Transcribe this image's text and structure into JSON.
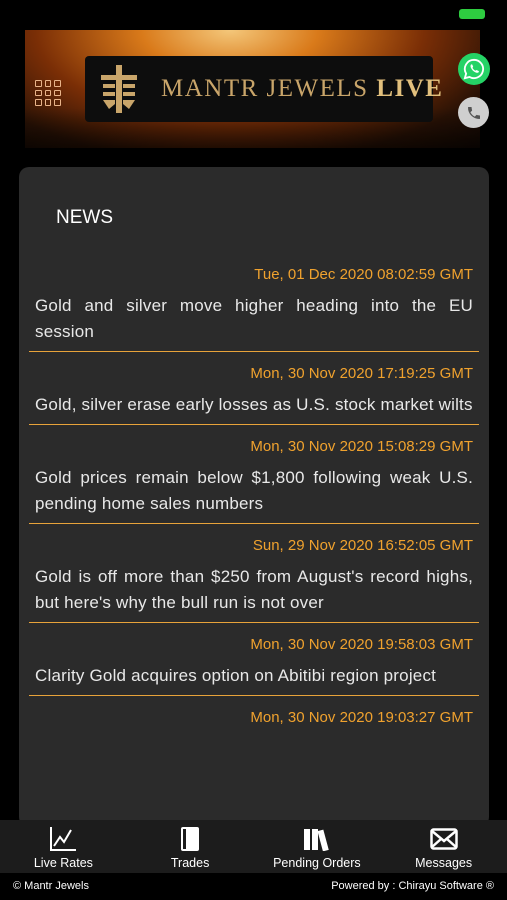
{
  "status_bar": {
    "battery_color": "#2ecc40"
  },
  "header": {
    "brand_text": "MANTR JEWELS",
    "brand_suffix": "LIVE",
    "menu_icon": "grid-menu-icon",
    "whatsapp_icon": "whatsapp-icon",
    "phone_icon": "phone-icon"
  },
  "news": {
    "title": "NEWS",
    "items": [
      {
        "date": "Tue, 01 Dec 2020 08:02:59 GMT",
        "headline": "Gold and silver move higher heading into the EU session"
      },
      {
        "date": "Mon, 30 Nov 2020 17:19:25 GMT",
        "headline": "Gold, silver erase early losses as U.S. stock market wilts"
      },
      {
        "date": "Mon, 30 Nov 2020 15:08:29 GMT",
        "headline": "Gold prices remain below $1,800 following weak U.S. pending home sales numbers"
      },
      {
        "date": "Sun, 29 Nov 2020 16:52:05 GMT",
        "headline": "Gold is off more than $250 from August's record highs, but here's why the bull run is not over"
      },
      {
        "date": "Mon, 30 Nov 2020 19:58:03 GMT",
        "headline": "Clarity Gold acquires option on Abitibi region project"
      },
      {
        "date": "Mon, 30 Nov 2020 19:03:27 GMT",
        "headline": ""
      }
    ]
  },
  "tabbar": {
    "tabs": [
      {
        "label": "Live Rates",
        "icon": "chart-icon"
      },
      {
        "label": "Trades",
        "icon": "book-icon"
      },
      {
        "label": "Pending Orders",
        "icon": "books-icon"
      },
      {
        "label": "Messages",
        "icon": "mail-icon"
      }
    ]
  },
  "footer": {
    "left": "© Mantr Jewels",
    "right": "Powered by : Chirayu Software ®"
  },
  "colors": {
    "accent": "#f0a22e",
    "card_bg": "#2b2b2b",
    "tabbar_bg": "#1c1c1c"
  }
}
